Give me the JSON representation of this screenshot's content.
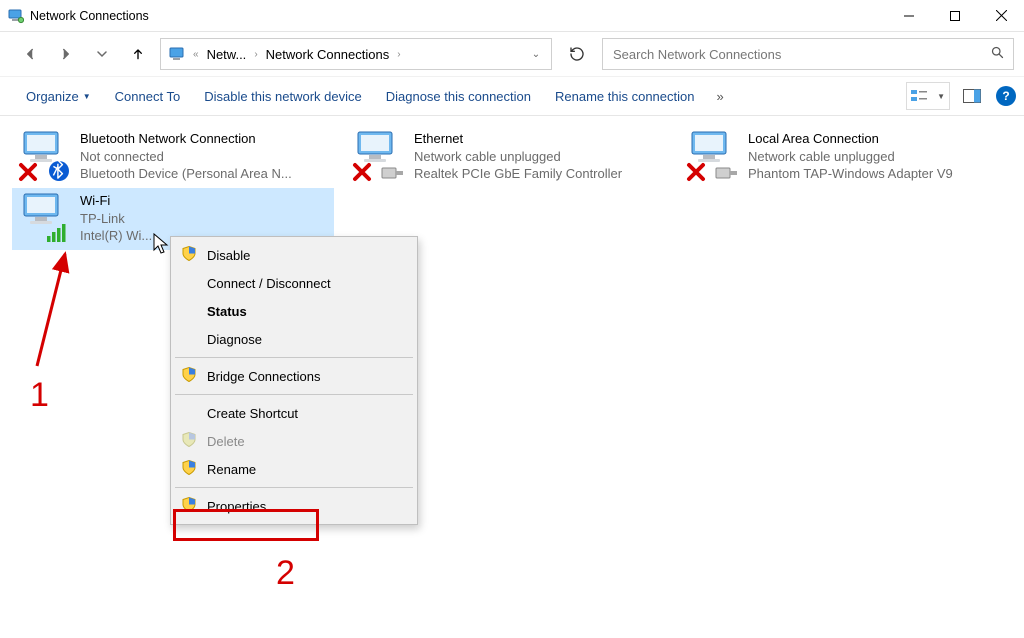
{
  "window": {
    "title": "Network Connections"
  },
  "breadcrumbs": {
    "root": "Netw...",
    "current": "Network Connections"
  },
  "search": {
    "placeholder": "Search Network Connections"
  },
  "toolbar": {
    "organize": "Organize",
    "connect_to": "Connect To",
    "disable": "Disable this network device",
    "diagnose": "Diagnose this connection",
    "rename": "Rename this connection"
  },
  "connections": [
    {
      "name": "Bluetooth Network Connection",
      "status": "Not connected",
      "device": "Bluetooth Device (Personal Area N..."
    },
    {
      "name": "Ethernet",
      "status": "Network cable unplugged",
      "device": "Realtek PCIe GbE Family Controller"
    },
    {
      "name": "Local Area Connection",
      "status": "Network cable unplugged",
      "device": "Phantom TAP-Windows Adapter V9"
    },
    {
      "name": "Wi-Fi",
      "status": "TP-Link",
      "device": "Intel(R) Wi..."
    }
  ],
  "context_menu": {
    "disable": "Disable",
    "connect_disconnect": "Connect / Disconnect",
    "status": "Status",
    "diagnose": "Diagnose",
    "bridge": "Bridge Connections",
    "create_shortcut": "Create Shortcut",
    "delete": "Delete",
    "rename": "Rename",
    "properties": "Properties"
  },
  "annotations": {
    "one": "1",
    "two": "2"
  }
}
